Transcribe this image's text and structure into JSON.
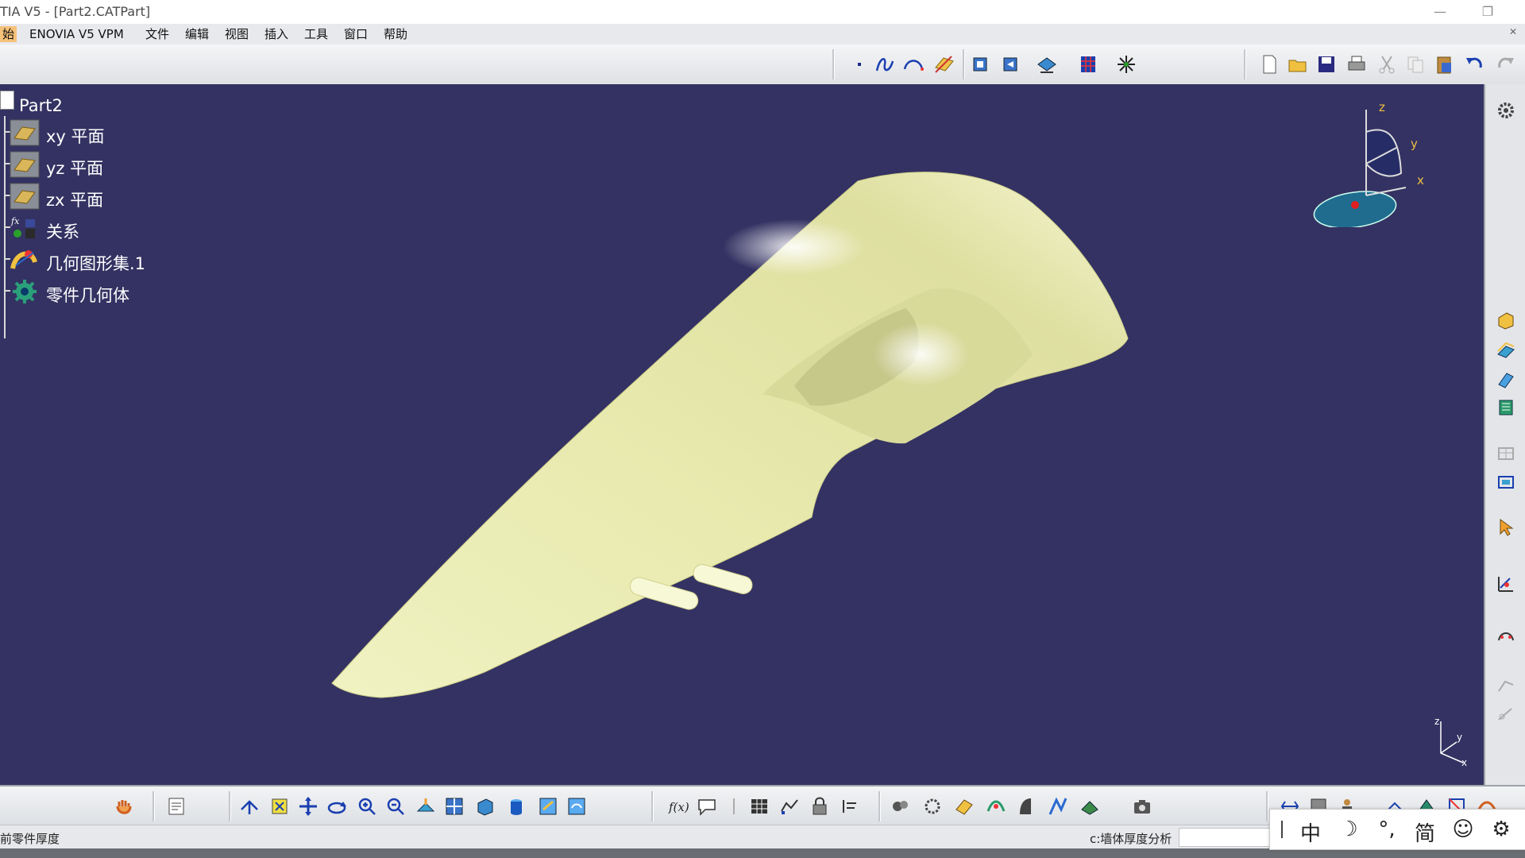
{
  "window": {
    "title": "TIA V5 - [Part2.CATPart]",
    "controls": {
      "minimize": "—",
      "restore": "❐"
    }
  },
  "menu": {
    "items": [
      "始",
      "ENOVIA V5 VPM",
      "文件",
      "编辑",
      "视图",
      "插入",
      "工具",
      "窗口",
      "帮助"
    ],
    "active_index": 0,
    "close_glyph": "✕"
  },
  "toolbar_top": {
    "icons": [
      "point-icon",
      "spline-icon",
      "curve-icon",
      "plane-icon",
      "view-front-icon",
      "view-back-icon",
      "measure-icon",
      "grid-icon",
      "compass-tool-icon",
      "new-file-icon",
      "open-file-icon",
      "save-icon",
      "print-icon",
      "cut-icon",
      "copy-icon",
      "paste-icon",
      "undo-icon",
      "redo-icon"
    ]
  },
  "tree": {
    "root": "Part2",
    "nodes": [
      {
        "label": "xy 平面",
        "icon": "plane-icon"
      },
      {
        "label": "yz 平面",
        "icon": "plane-icon"
      },
      {
        "label": "zx 平面",
        "icon": "plane-icon"
      },
      {
        "label": "关系",
        "icon": "relations-icon"
      },
      {
        "label": "几何图形集.1",
        "icon": "geometric-set-icon"
      },
      {
        "label": "零件几何体",
        "icon": "part-body-icon"
      }
    ]
  },
  "compass": {
    "x": "x",
    "y": "y",
    "z": "z"
  },
  "mini_axes": {
    "x": "x",
    "y": "y",
    "z": "z"
  },
  "colors": {
    "viewport_bg": "#343262",
    "part_surface": "#e7e9ad",
    "compass_fill": "#1f6c8f"
  },
  "status": {
    "left_text": "前零件厚度",
    "right_text": "c:墙体厚度分析"
  },
  "ime": {
    "keys": [
      "中",
      "☽",
      "°,",
      "简",
      "☺",
      "⚙"
    ]
  }
}
